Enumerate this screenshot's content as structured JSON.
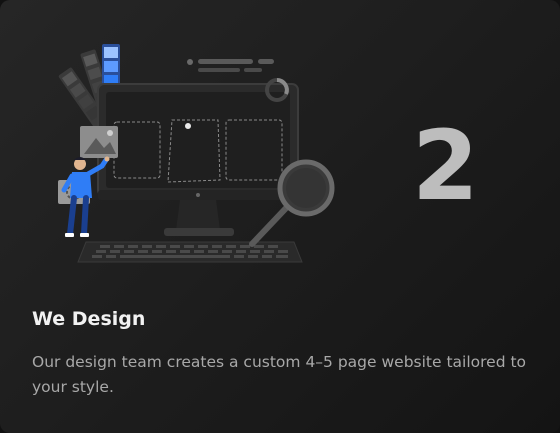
{
  "card": {
    "step_number": "2",
    "title": "We Design",
    "description": "Our design team creates a custom 4–5 page website tailored to your style."
  },
  "illustration": {
    "icon": "web-design-illustration",
    "colors": {
      "accent_blue": "#2f7df6",
      "monitor_dark": "#2b2b2b",
      "dashed_outline": "#8a8a8a"
    }
  }
}
